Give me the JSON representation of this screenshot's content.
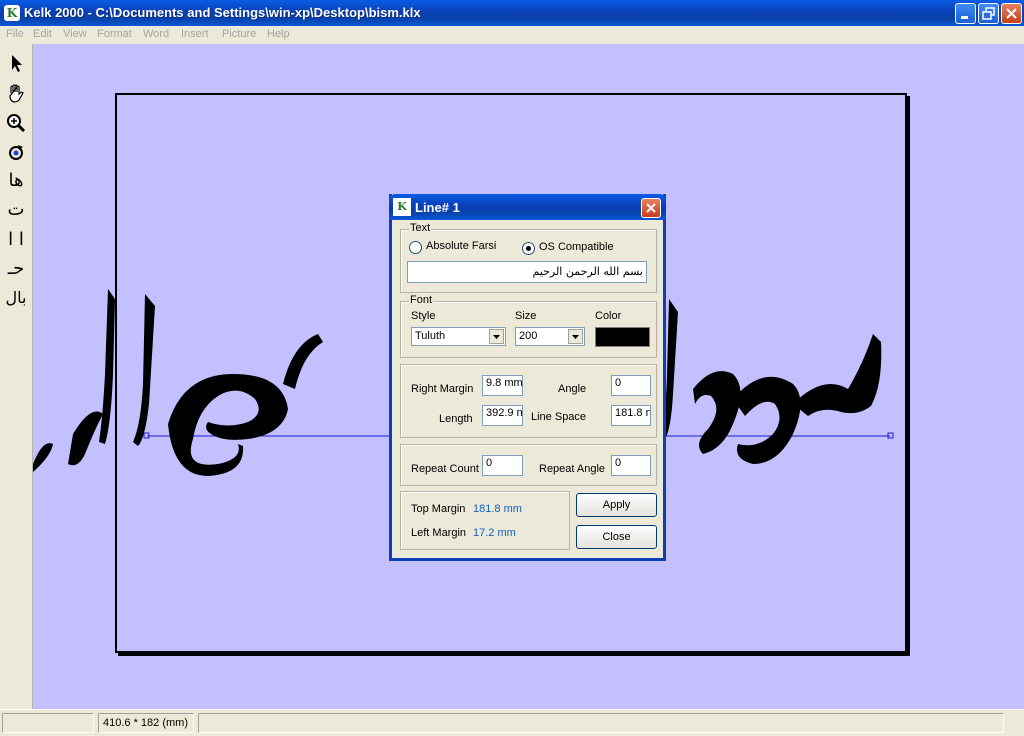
{
  "window": {
    "logo_text": "K",
    "title": "Kelk 2000 - C:\\Documents and Settings\\win-xp\\Desktop\\bism.klx"
  },
  "menu": [
    "File",
    "Edit",
    "View",
    "Format",
    "Word",
    "Insert",
    "Picture",
    "Help"
  ],
  "toolbox": [
    "pointer-tool",
    "hand-tool",
    "zoom-tool",
    "rotate-tool",
    "letter-ha-tool",
    "letter-ta-tool",
    "letter-alef-tool",
    "letter-jim-tool",
    "letter-ba-tool"
  ],
  "tool_glyphs": {
    "letter_ha": "ها",
    "letter_ta": "ت",
    "letter_alef": "ا ا",
    "letter_jim": "حـ",
    "letter_ba": "بال"
  },
  "dialog": {
    "icon_text": "K",
    "title": "Line# 1",
    "text_group": {
      "label": "Text",
      "options": [
        "Absolute Farsi",
        "OS Compatible"
      ],
      "selected": "OS Compatible",
      "value": "بسم الله الرحمن الرحيم"
    },
    "font_group": {
      "label": "Font",
      "style_label": "Style",
      "style_value": "Tuluth",
      "size_label": "Size",
      "size_value": "200",
      "color_label": "Color",
      "color_value": "#000000"
    },
    "layout_group": {
      "right_margin_label": "Right Margin",
      "right_margin_value": "9.8 mm",
      "angle_label": "Angle",
      "angle_value": "0",
      "length_label": "Length",
      "length_value": "392.9 n",
      "line_space_label": "Line Space",
      "line_space_value": "181.8 n"
    },
    "repeat_group": {
      "repeat_count_label": "Repeat Count",
      "repeat_count_value": "0",
      "repeat_angle_label": "Repeat Angle",
      "repeat_angle_value": "0"
    },
    "info_group": {
      "top_margin_label": "Top Margin",
      "top_margin_value": "181.8 mm",
      "left_margin_label": "Left Margin",
      "left_margin_value": "17.2 mm"
    },
    "apply_label": "Apply",
    "close_label": "Close"
  },
  "statusbar": {
    "pane1": "",
    "dimensions": "410.6 * 182 (mm)",
    "pane3": ""
  },
  "colors": {
    "workspace": "#c4c0ff",
    "titlebar": "#0a3fb8",
    "info_text": "#1660c0",
    "calligraphy": "#000000"
  }
}
